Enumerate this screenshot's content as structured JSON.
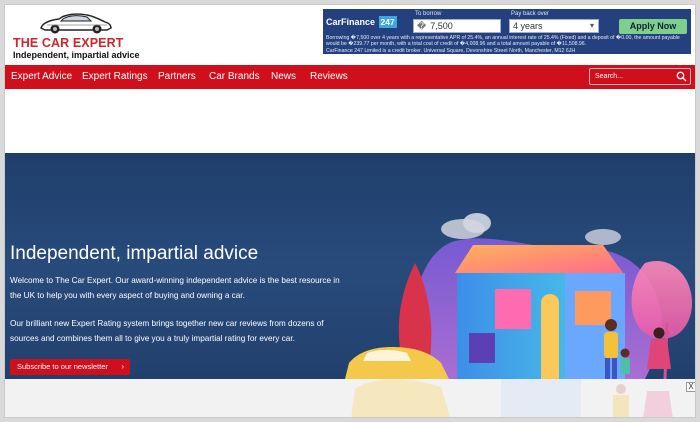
{
  "site": {
    "logo_title": "THE CAR EXPERT",
    "logo_tagline": "Independent, impartial advice"
  },
  "ad": {
    "brand": "CarFinance",
    "brand_badge": "247",
    "borrow_label": "To borrow",
    "borrow_currency": "�",
    "borrow_value": "7,500",
    "term_label": "Pay back over",
    "term_value": "4 years",
    "apply_label": "Apply Now",
    "fine_print_1": "Borrowing �7,500 over 4 years with a representative APR of 25.4%, an annual interest rate of 25.4% (Fixed) and a deposit of �0.00, the amount payable would be �239.77 per month, with a total cost of credit of �4,008.96 and a total amount payable of �11,508.96.",
    "fine_print_2": "CarFinance 247 Limited is a credit broker. Universal Square, Devonshire Street North, Manchester, M12 6JH"
  },
  "nav": {
    "items": [
      {
        "label": "Expert Advice"
      },
      {
        "label": "Expert Ratings"
      },
      {
        "label": "Partners"
      },
      {
        "label": "Car Brands"
      },
      {
        "label": "News"
      },
      {
        "label": "Reviews"
      }
    ],
    "search_placeholder": "Search..."
  },
  "hero": {
    "title": "Independent, impartial advice",
    "paragraph_1": "Welcome to The Car Expert. Our award-winning independent advice is the best resource in the UK to help you with every aspect of buying and owning a car.",
    "paragraph_2": "Our brilliant new Expert Rating system brings together new car reviews from dozens of sources and combines them all to give you a truly impartial rating for every car.",
    "button_label": "Subscribe to our newsletter"
  },
  "overlay": {
    "close_label": "X"
  },
  "colors": {
    "brand_red": "#d00f1c",
    "hero_navy": "#284b7c",
    "ad_blue": "#24407f",
    "apply_green": "#7ccf8c"
  },
  "icons": [
    "car-logo-icon",
    "search-icon",
    "chevron-down-icon",
    "chevron-right-icon",
    "close-icon"
  ]
}
